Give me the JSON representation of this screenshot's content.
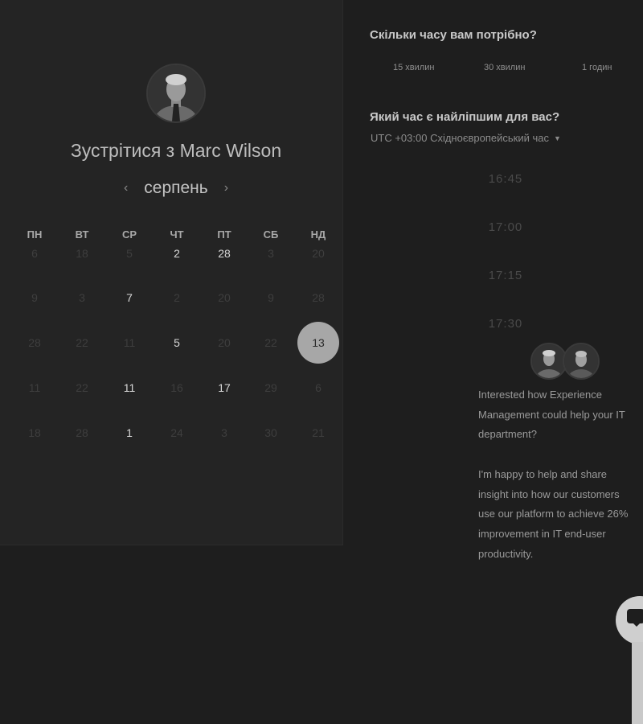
{
  "host": {
    "title": "Зустрітися з Marc Wilson"
  },
  "calendar": {
    "month": "серпень",
    "weekdays": [
      "ПН",
      "ВТ",
      "СР",
      "ЧТ",
      "ПТ",
      "СБ",
      "НД"
    ],
    "days": [
      [
        "6",
        "18",
        "5",
        "2",
        "28",
        "3",
        "20"
      ],
      [
        "9",
        "3",
        "7",
        "2",
        "20",
        "9",
        "28"
      ],
      [
        "28",
        "22",
        "11",
        "5",
        "20",
        "22",
        "13"
      ],
      [
        "11",
        "22",
        "11",
        "16",
        "17",
        "29",
        "6"
      ],
      [
        "18",
        "28",
        "1",
        "24",
        "3",
        "30",
        "21"
      ]
    ],
    "available": [
      [
        false,
        false,
        false,
        true,
        true,
        false,
        false
      ],
      [
        false,
        false,
        true,
        false,
        false,
        false,
        false
      ],
      [
        false,
        false,
        false,
        true,
        false,
        false,
        true
      ],
      [
        false,
        false,
        true,
        false,
        true,
        false,
        false
      ],
      [
        false,
        false,
        true,
        false,
        false,
        false,
        false
      ]
    ],
    "selected": {
      "row": 2,
      "col": 6
    }
  },
  "duration": {
    "question": "Скільки часу вам потрібно?",
    "options": [
      "15 хвилин",
      "30 хвилин",
      "1 годин"
    ]
  },
  "time": {
    "question": "Який час є найліпшим для вас?",
    "timezone": "UTC +03:00 Східноєвропейський час",
    "slots": [
      "16:45",
      "17:00",
      "17:15",
      "17:30"
    ]
  },
  "message": {
    "intro": "Interested how Experience\nManagement could help your IT\ndepartment?",
    "body": "I'm happy to help and share\ninsight into how our customers\nuse our platform to achieve 26%\nimprovement in IT end-user\nproductivity."
  },
  "icons": {
    "prev": "chevron-left-icon",
    "next": "chevron-right-icon",
    "tz_caret": "caret-down-icon",
    "chat": "chat-icon"
  }
}
